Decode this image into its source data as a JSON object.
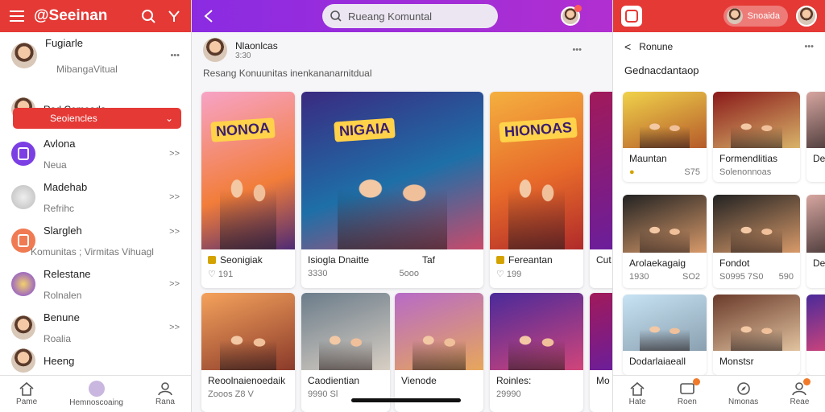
{
  "left": {
    "title": "@Seeinan",
    "profile": {
      "name": "Fugiarle",
      "sub": "MibangaVitual"
    },
    "items": [
      {
        "name": "Rad Comoada",
        "sub": "Seoiencles",
        "active": true
      },
      {
        "name": "Avlona",
        "sub": "Neua",
        "icon_color": "#7b3fe4"
      },
      {
        "name": "Madehab",
        "sub": "Refrihc"
      },
      {
        "name": "Slargleh",
        "sub": "Komunitas ; Virmitas Vihuagl",
        "icon_color": "#f07a52"
      },
      {
        "name": "Relestane",
        "sub": "Rolnalen"
      },
      {
        "name": "Benune",
        "sub": "Roalia"
      },
      {
        "name": "Heeng",
        "sub": ""
      }
    ],
    "nav": [
      "Pame",
      "Hemnoscoaing",
      "Rana"
    ]
  },
  "mid": {
    "search_placeholder": "Rueang Komuntal",
    "post": {
      "author": "Nlaonlcas",
      "time": "3:30",
      "text": "Resang Konuunitas inenkananarnitdual"
    },
    "cards": [
      {
        "title": "Seonigiak",
        "likes": "191",
        "sign": "NONOA"
      },
      {
        "title": "Isiogla Dnaitte",
        "title2": "Taf",
        "likes": "3330",
        "likes2": "5ooo",
        "sign": "NIGAIA"
      },
      {
        "title": "Fereantan",
        "likes": "199",
        "sign": "HIONOAS"
      },
      {
        "title": "Cut",
        "likes": ""
      },
      {
        "title": "Reoolnaienoedaik",
        "likes": "Zooos Z8 V"
      },
      {
        "title": "Caodientian",
        "likes": "9990 Sl"
      },
      {
        "title": "Vienode",
        "likes": ""
      },
      {
        "title": "Roinles:",
        "likes": "29990"
      },
      {
        "title": "Mo",
        "likes": ""
      }
    ]
  },
  "right": {
    "badge_name": "Snoaida",
    "back": "Ronune",
    "section": "Gednacdantaop",
    "cards": [
      {
        "title": "Mauntan",
        "a": "",
        "b": "S75"
      },
      {
        "title": "Formendlitias",
        "a": "Solenonnoas",
        "b": ""
      },
      {
        "title": "Dei",
        "a": "",
        "b": ""
      },
      {
        "title": "Arolaekagaig",
        "a": "1930",
        "b": "SO2"
      },
      {
        "title": "Fondot",
        "a": "S0995 7S0",
        "b": "590"
      },
      {
        "title": "Deli",
        "a": "",
        "b": ""
      },
      {
        "title": "Dodarlaiaeall",
        "a": "",
        "b": ""
      },
      {
        "title": "Monstsr",
        "a": "",
        "b": ""
      },
      {
        "title": "",
        "a": "",
        "b": ""
      }
    ],
    "nav": [
      "Hate",
      "Roen",
      "Nmonas",
      "Reae"
    ]
  }
}
